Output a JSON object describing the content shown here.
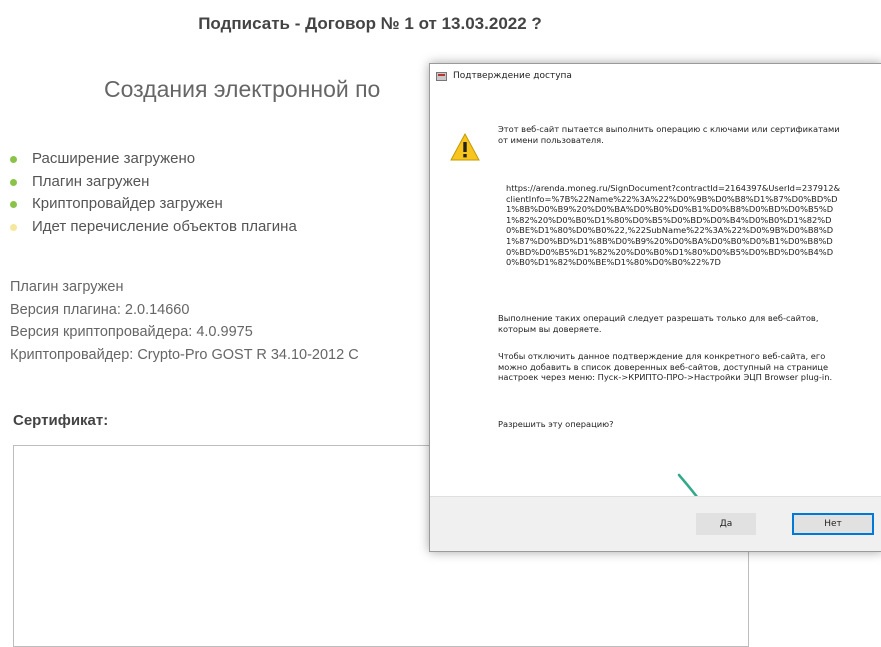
{
  "page": {
    "title": "Подписать - Договор № 1 от 13.03.2022 ?",
    "subtitle": "Создания электронной по"
  },
  "status_items": [
    {
      "label": "Расширение загружено",
      "color": "#8bc34a"
    },
    {
      "label": "Плагин загружен",
      "color": "#8bc34a"
    },
    {
      "label": "Криптопровайдер загружен",
      "color": "#8bc34a"
    },
    {
      "label": "Идет перечисление объектов плагина",
      "color": "#f5e79e"
    }
  ],
  "plugin_info": {
    "loaded": "Плагин загружен",
    "plugin_version": "Версия плагина: 2.0.14660",
    "csp_version": "Версия криптопровайдера: 4.0.9975",
    "csp_name": "Криптопровайдер: Crypto-Pro GOST R 34.10-2012 C"
  },
  "certificate": {
    "label": "Сертификат:"
  },
  "dialog": {
    "title": "Подтверждение доступа",
    "warning_text": "Этот веб-сайт пытается выполнить операцию с ключами или сертификатами от имени пользователя.",
    "url": "https://arenda.moneg.ru/SignDocument?contractId=2164397&UserId=237912&clientInfo=%7B%22Name%22%3A%22%D0%9B%D0%B8%D1%87%D0%BD%D1%8B%D0%B9%20%D0%BA%D0%B0%D0%B1%D0%B8%D0%BD%D0%B5%D1%82%20%D0%B0%D1%80%D0%B5%D0%BD%D0%B4%D0%B0%D1%82%D0%BE%D1%80%D0%B0%22,%22SubName%22%3A%22%D0%9B%D0%B8%D1%87%D0%BD%D1%8B%D0%B9%20%D0%BA%D0%B0%D0%B1%D0%B8%D0%BD%D0%B5%D1%82%20%D0%B0%D1%80%D0%B5%D0%BD%D0%B4%D0%B0%D1%82%D0%BE%D1%80%D0%B0%22%7D",
    "permit_text": "Выполнение таких операций следует разрешать только для веб-сайтов, которым вы доверяете.",
    "disable_text": "Чтобы отключить данное подтверждение для конкретного веб-сайта, его можно добавить в список доверенных веб-сайтов, доступный на странице настроек через меню: Пуск->КРИПТО-ПРО->Настройки ЭЦП Browser plug-in.",
    "question": "Разрешить эту операцию?",
    "yes_label": "Да",
    "no_label": "Нет"
  }
}
